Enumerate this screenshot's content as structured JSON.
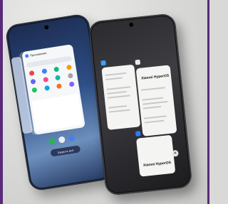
{
  "scene": {
    "background": "#d9d9d7",
    "frame_color": "#5a2a7a"
  },
  "left_phone": {
    "recents_header": "Приложения",
    "button_label": "Закрыть все"
  },
  "right_phone": {
    "card_b_brand": "Xiaomi HyperOS",
    "card_c_brand": "Xiaomi HyperOS"
  }
}
